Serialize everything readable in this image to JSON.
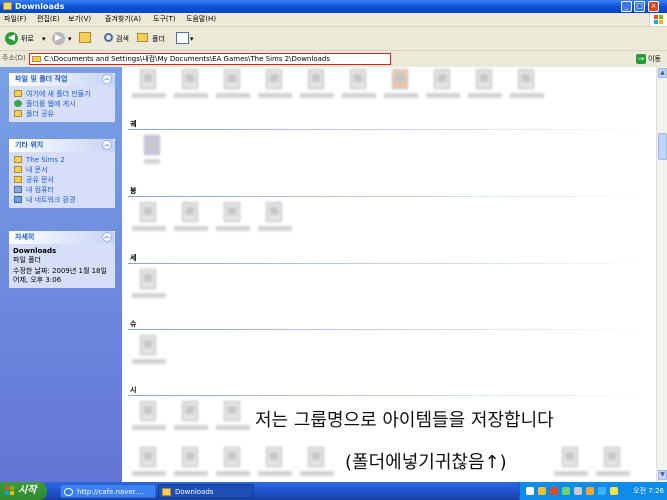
{
  "window": {
    "title": "Downloads"
  },
  "menu": [
    "파일(F)",
    "편집(E)",
    "보기(V)",
    "즐겨찾기(A)",
    "도구(T)",
    "도움말(H)"
  ],
  "toolbar": {
    "back_label": "뒤로",
    "search_label": "검색",
    "folders_label": "폴더"
  },
  "address": {
    "label": "주소(D)",
    "value": "C:\\Documents and Settings\\내컴\\My Documents\\EA Games\\The Sims 2\\Downloads",
    "go_label": "이동"
  },
  "sidebar": {
    "tasks": {
      "title": "파일 및 폴더 작업",
      "items": [
        "여기에 새 폴더 만들기",
        "폴더를 웹에 게시",
        "폴더 공유"
      ]
    },
    "places": {
      "title": "기타 위치",
      "items": [
        "The Sims 2",
        "내 문서",
        "공유 문서",
        "내 컴퓨터",
        "내 네트워크 환경"
      ]
    },
    "details": {
      "title": "자세히",
      "name": "Downloads",
      "type": "파일 폴더",
      "modified": "수정한 날짜: 2009년 1월 18일 어제, 오후 3:06"
    }
  },
  "groups": [
    "궤",
    "봉",
    "세",
    "슈",
    "시"
  ],
  "overlay": {
    "line1": "저는 그룹명으로 아이템들을 저장합니다",
    "line2": "(폴더에넣기귀찮음↑)"
  },
  "taskbar": {
    "start_label": "시작",
    "tasks": [
      "http://cafe.naver....",
      "Downloads"
    ],
    "clock": "오전 7:26"
  },
  "colors": {
    "titlebar": "#0a53d6",
    "sidebar": "#7aa1e6",
    "address_highlight": "#d9231a",
    "start": "#3c9a3c"
  }
}
